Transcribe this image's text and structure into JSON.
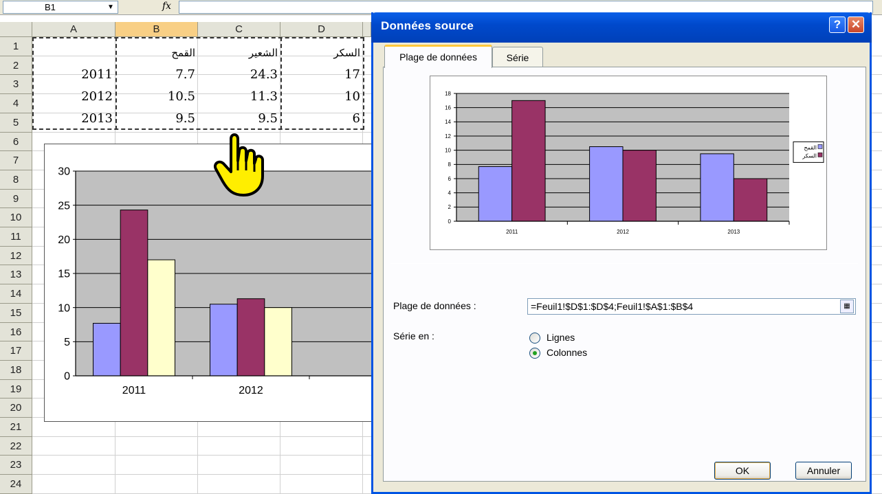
{
  "formula_bar": {
    "name_box": "B1",
    "fx_icon": "fx-icon"
  },
  "sheet": {
    "columns": [
      "A",
      "B",
      "C",
      "D"
    ],
    "rows": [
      "1",
      "2",
      "3",
      "4",
      "5",
      "6",
      "7",
      "8",
      "9",
      "10",
      "11",
      "12",
      "13",
      "14",
      "15",
      "16",
      "17",
      "18",
      "19",
      "20",
      "21",
      "22",
      "23",
      "24"
    ],
    "headers": [
      "القمح",
      "الشعير",
      "السكر"
    ],
    "data": [
      {
        "year": "2011",
        "b": "7.7",
        "c": "24.3",
        "d": "17"
      },
      {
        "year": "2012",
        "b": "10.5",
        "c": "11.3",
        "d": "10"
      },
      {
        "year": "2013",
        "b": "9.5",
        "c": "9.5",
        "d": "6"
      }
    ]
  },
  "chart_data": [
    {
      "type": "bar",
      "categories": [
        "2011",
        "2012"
      ],
      "series": [
        {
          "values": [
            7.7,
            10.5
          ],
          "color": "#9999ff"
        },
        {
          "values": [
            24.3,
            11.3
          ],
          "color": "#993366"
        },
        {
          "values": [
            17,
            10
          ],
          "color": "#ffffcc"
        }
      ],
      "ylim": [
        0,
        30
      ],
      "yticks": [
        "0",
        "5",
        "10",
        "15",
        "20",
        "25",
        "30"
      ],
      "plot_bg": "#c0c0c0",
      "grid": true,
      "legend": "none"
    },
    {
      "type": "bar",
      "categories": [
        "2011",
        "2012",
        "2013"
      ],
      "series": [
        {
          "name": "القمح",
          "values": [
            7.7,
            10.5,
            9.5
          ],
          "color": "#9999ff"
        },
        {
          "name": "السكر",
          "values": [
            17,
            10,
            6
          ],
          "color": "#993366"
        }
      ],
      "ylim": [
        0,
        18
      ],
      "yticks": [
        "0",
        "2",
        "4",
        "6",
        "8",
        "10",
        "12",
        "14",
        "16",
        "18"
      ],
      "plot_bg": "#c0c0c0",
      "grid": true,
      "legend": "right"
    }
  ],
  "dialog": {
    "title": "Données source",
    "help": "?",
    "close": "✕",
    "tabs": [
      "Plage de données",
      "Série"
    ],
    "range_label": "Plage de données :",
    "range_value": "=Feuil1!$D$1:$D$4;Feuil1!$A$1:$B$4",
    "series_in_label": "Série en :",
    "radio_rows": "Lignes",
    "radio_cols": "Colonnes",
    "ok": "OK",
    "cancel": "Annuler"
  },
  "colors": {
    "title_bar": "#0054e3",
    "dialog_bg": "#ece9d8",
    "selection_header": "#f8cf85"
  }
}
